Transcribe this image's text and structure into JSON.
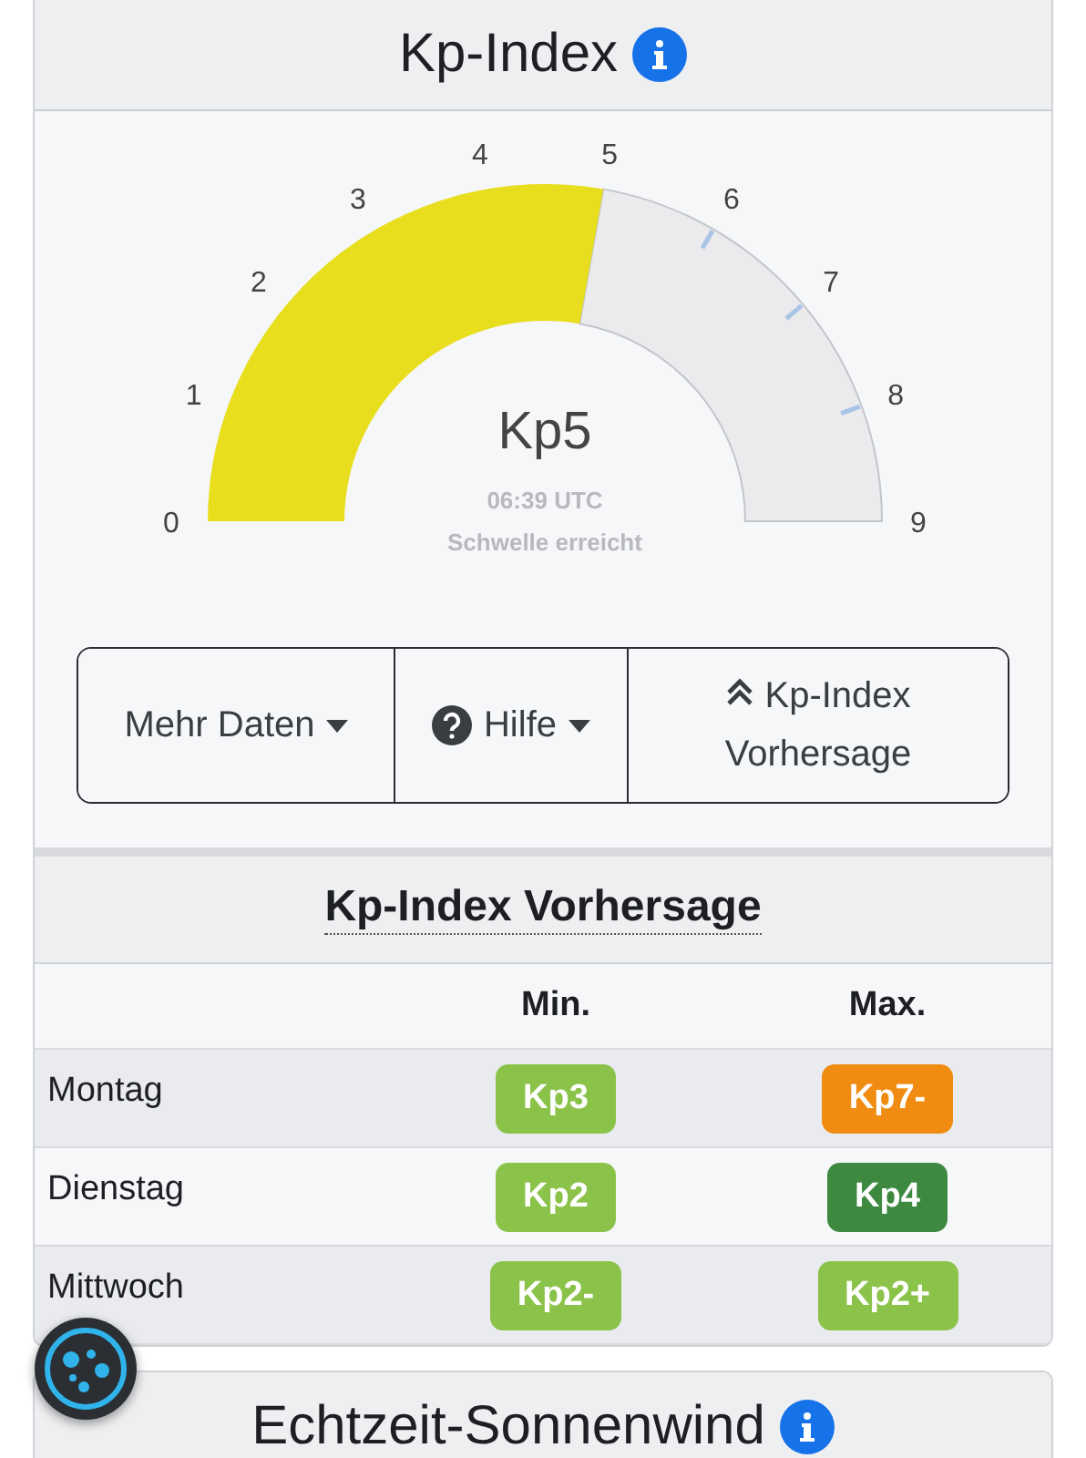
{
  "kp_card": {
    "title": "Kp-Index",
    "gauge": {
      "value": "Kp5",
      "time": "06:39 UTC",
      "status": "Schwelle erreicht",
      "tick_labels": [
        "0",
        "1",
        "2",
        "3",
        "4",
        "5",
        "6",
        "7",
        "8",
        "9"
      ]
    },
    "buttons": [
      {
        "label": "Mehr Daten",
        "kind": "dropdown"
      },
      {
        "label": "Hilfe",
        "kind": "help-dropdown"
      },
      {
        "label": "Kp-Index Vorhersage",
        "kind": "collapse"
      }
    ]
  },
  "forecast": {
    "title": "Kp-Index Vorhersage",
    "columns": [
      "Min.",
      "Max."
    ],
    "rows": [
      {
        "day": "Montag",
        "min": {
          "text": "Kp3",
          "color": "#8bc34a"
        },
        "max": {
          "text": "Kp7-",
          "color": "#f08c12"
        }
      },
      {
        "day": "Dienstag",
        "min": {
          "text": "Kp2",
          "color": "#8bc34a"
        },
        "max": {
          "text": "Kp4",
          "color": "#3e8940"
        }
      },
      {
        "day": "Mittwoch",
        "min": {
          "text": "Kp2-",
          "color": "#8bc34a"
        },
        "max": {
          "text": "Kp2+",
          "color": "#8bc34a"
        }
      }
    ]
  },
  "solar_wind_card": {
    "title": "Echtzeit-Sonnenwind"
  }
}
